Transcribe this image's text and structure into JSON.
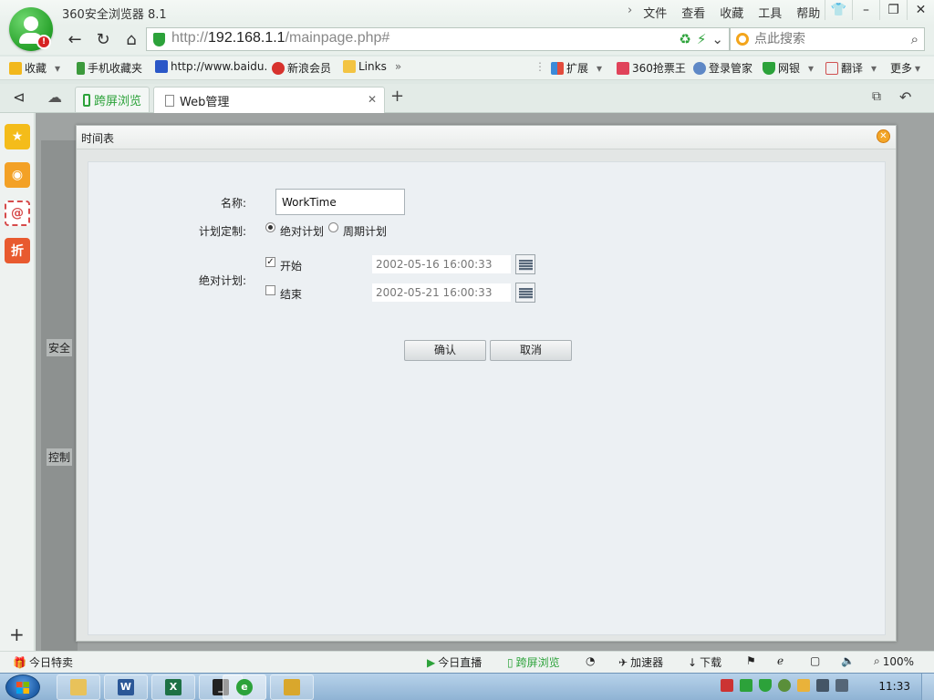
{
  "window": {
    "app_title": "360安全浏览器 8.1",
    "menu": [
      "文件",
      "查看",
      "收藏",
      "工具",
      "帮助"
    ]
  },
  "address_bar": {
    "url_prefix": "http://",
    "url_host": "192.168.1.1",
    "url_path": "/mainpage.php#",
    "search_placeholder": "点此搜索"
  },
  "bookmarks": {
    "left": [
      "收藏",
      "手机收藏夹",
      "http://www.baidu.",
      "新浪会员",
      "Links"
    ],
    "right": [
      "扩展",
      "360抢票王",
      "登录管家",
      "网银",
      "翻译",
      "更多"
    ]
  },
  "tabs": [
    {
      "label": "跨屏浏览"
    },
    {
      "label": "Web管理"
    }
  ],
  "page": {
    "categories": [
      "安全",
      "控制"
    ]
  },
  "dialog": {
    "title": "时间表",
    "name_label": "名称:",
    "name_value": "WorkTime",
    "plan_label": "计划定制:",
    "plan_options": [
      "绝对计划",
      "周期计划"
    ],
    "plan_selected": "绝对计划",
    "absolute_label": "绝对计划:",
    "start": {
      "label": "开始",
      "checked": true,
      "value": "2002-05-16 16:00:33"
    },
    "end": {
      "label": "结束",
      "checked": false,
      "value": "2002-05-21 16:00:33"
    },
    "confirm_label": "确认",
    "cancel_label": "取消"
  },
  "statusbar": {
    "left": "今日特卖",
    "items": [
      "今日直播",
      "跨屏浏览",
      "加速器",
      "下载"
    ],
    "zoom": "100%"
  },
  "taskbar": {
    "clock": "11:33"
  },
  "colors": {
    "brand_green": "#2ca23a",
    "dialog_bg": "#ecf0f3",
    "close_orange": "#f3a628",
    "taskbar_blue": "#8fb3d4"
  }
}
